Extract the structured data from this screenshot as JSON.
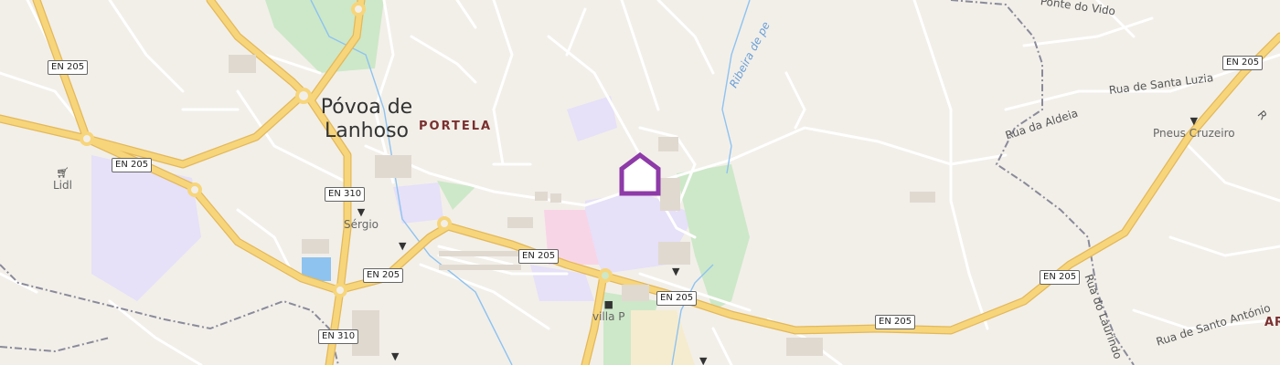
{
  "town": {
    "line1": "Póvoa de",
    "line2": "Lanhoso"
  },
  "district": "PORTELA",
  "district_right": "AR",
  "road_shields": [
    {
      "id": "en205-a",
      "label": "EN 205"
    },
    {
      "id": "en205-b",
      "label": "EN 205"
    },
    {
      "id": "en205-c",
      "label": "EN 205"
    },
    {
      "id": "en205-d",
      "label": "EN 205"
    },
    {
      "id": "en205-e",
      "label": "EN 205"
    },
    {
      "id": "en205-f",
      "label": "EN 205"
    },
    {
      "id": "en205-g",
      "label": "EN 205"
    },
    {
      "id": "en205-h",
      "label": "EN 205"
    },
    {
      "id": "en310-a",
      "label": "EN 310"
    },
    {
      "id": "en310-b",
      "label": "EN 310"
    }
  ],
  "pois": {
    "lidl": "Lidl",
    "sergio": "Sérgio",
    "villa": "villa P",
    "pneus": "Pneus Cruzeiro"
  },
  "streets": {
    "santa_luzia": "Rua de Santa Luzia",
    "aldeia": "Rua da Aldeia",
    "laurindo": "Rua do Laurindo",
    "santo_antonio": "Rua de Santo António",
    "vido": "Ponte do Vido",
    "top_right": "R"
  },
  "waterway": "Ribeira de pe",
  "colors": {
    "background": "#f2efe9",
    "major_road": "#f7d57a",
    "major_road_casing": "#e3b85a",
    "water": "#8ec3f0",
    "school": "#e6e0f8",
    "park": "#cde8c8",
    "hospital": "#f8d5e6",
    "marker": "#8e3aa8"
  },
  "marker_icon": "home-marker-icon"
}
